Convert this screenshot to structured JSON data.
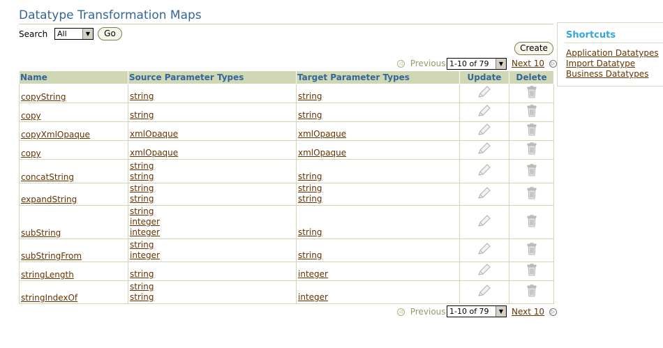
{
  "page": {
    "title": "Datatype Transformation Maps"
  },
  "search": {
    "label": "Search",
    "selected": "All",
    "go_label": "Go"
  },
  "actions": {
    "create_label": "Create"
  },
  "pager": {
    "previous_label": "Previous",
    "range": "1-10 of 79",
    "next_label": "Next 10"
  },
  "table": {
    "headers": {
      "name": "Name",
      "source": "Source Parameter Types",
      "target": "Target Parameter Types",
      "update": "Update",
      "delete": "Delete"
    },
    "rows": [
      {
        "name": "copyString",
        "source": [
          "string"
        ],
        "target": [
          "string"
        ]
      },
      {
        "name": "copy",
        "source": [
          "string"
        ],
        "target": [
          "string"
        ]
      },
      {
        "name": "copyXmlOpaque",
        "source": [
          "xmlOpaque"
        ],
        "target": [
          "xmlOpaque"
        ]
      },
      {
        "name": "copy",
        "source": [
          "xmlOpaque"
        ],
        "target": [
          "xmlOpaque"
        ]
      },
      {
        "name": "concatString",
        "source": [
          "string",
          "string"
        ],
        "target": [
          "string"
        ]
      },
      {
        "name": "expandString",
        "source": [
          "string",
          "string"
        ],
        "target": [
          "string",
          "string"
        ]
      },
      {
        "name": "subString",
        "source": [
          "string",
          "integer",
          "integer"
        ],
        "target": [
          "string"
        ]
      },
      {
        "name": "subStringFrom",
        "source": [
          "string",
          "integer"
        ],
        "target": [
          "string"
        ]
      },
      {
        "name": "stringLength",
        "source": [
          "string"
        ],
        "target": [
          "integer"
        ]
      },
      {
        "name": "stringIndexOf",
        "source": [
          "string",
          "string"
        ],
        "target": [
          "integer"
        ]
      }
    ]
  },
  "shortcuts": {
    "title": "Shortcuts",
    "links": [
      "Application Datatypes",
      "Import Datatype",
      "Business Datatypes"
    ]
  },
  "icons": {
    "update": "pencil-icon",
    "delete": "trash-icon",
    "previous": "previous-arrow-icon",
    "next": "next-arrow-icon"
  }
}
